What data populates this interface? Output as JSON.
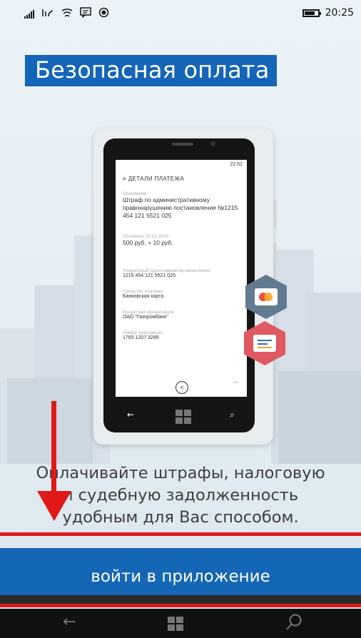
{
  "status_bar": {
    "time": "20:25",
    "icons": [
      "signal-icon",
      "wifi-icon",
      "wifi-sharing-icon",
      "message-icon",
      "location-icon"
    ]
  },
  "title": "Безопасная оплата",
  "phone_mock": {
    "time": "22:52",
    "header": "≡  ДЕТАЛИ ПЛАТЕЖА",
    "basis_label": "Основание",
    "basis_value": "Штраф по административному правонарушению постановление №1215 454 121 5521 025",
    "paid_label": "Оплачено 30.01.2015",
    "paid_value": "500 руб. + 10 руб.",
    "uid_label": "Уникальный идентификатор начисления",
    "uid_value": "1215 454 121 5521 025",
    "method_label": "Средство платежа",
    "method_value": "Банковская карта",
    "org_label": "Кредитная организация",
    "org_value": "ОАО \"Газпромбанк\"",
    "txn_label": "Номер транзакции",
    "txn_value": "1765 1207 3289",
    "more": "..."
  },
  "description": {
    "line1": "Оплачивайте штрафы, налоговую",
    "line2": "и судебную задолженность",
    "line3": "удобным для Вас способом."
  },
  "cta_button": "войти в приложение",
  "colors": {
    "accent": "#1466b6",
    "annotation": "#e01818",
    "hex_gray": "#627a90",
    "hex_red": "#e05860"
  }
}
